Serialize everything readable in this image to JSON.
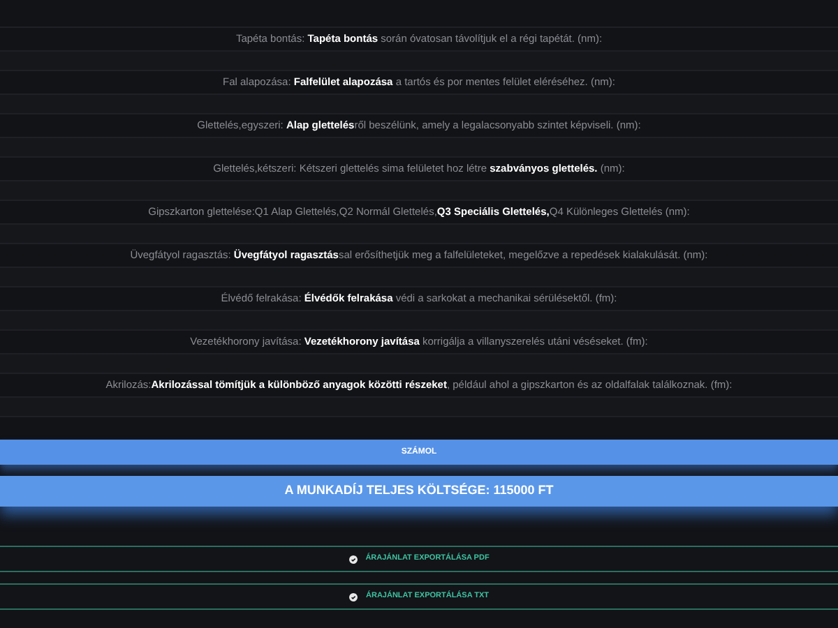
{
  "items": [
    {
      "label": "Tapéta bontás: **Tapéta bontás** során óvatosan távolítjuk el a régi tapétát. (nm):"
    },
    {
      "label": "Fal alapozása: **Falfelület alapozása** a tartós és por mentes felület eléréséhez. (nm):"
    },
    {
      "label": "Glettelés,egyszeri: **Alap glettelés**ről beszélünk, amely a legalacsonyabb szintet képviseli. (nm):"
    },
    {
      "label": "Glettelés,kétszeri: Kétszeri glettelés sima felületet hoz létre **szabványos glettelés.** (nm):"
    },
    {
      "label": "Gipszkarton glettelése:Q1 Alap Glettelés,Q2 Normál Glettelés,**Q3 Speciális Glettelés,**Q4 Különleges Glettelés (nm):"
    },
    {
      "label": "Üvegfátyol ragasztás: **Üvegfátyol ragasztás**sal erősíthetjük meg a falfelületeket, megelőzve a repedések kialakulását. (nm):"
    },
    {
      "label": "Élvédő felrakása: **Élvédők felrakása** védi a sarkokat a mechanikai sérülésektől. (fm):"
    },
    {
      "label": "Vezetékhorony javítása: **Vezetékhorony javítása** korrigálja a villanyszerelés utáni véséseket. (fm):"
    },
    {
      "label": "Akrilozás:**Akrilozással tömítjük a különböző anyagok közötti részeket**, például ahol a gipszkarton és az oldalfalak találkoznak. (fm):"
    }
  ],
  "calculate_button": "SZÁMOL",
  "total": "A MUNKADÍJ TELJES KÖLTSÉGE: 115000 FT",
  "export_buttons": [
    "ÁRAJÁNLAT EXPORTÁLÁSA PDF",
    "ÁRAJÁNLAT EXPORTÁLÁSA TXT"
  ]
}
